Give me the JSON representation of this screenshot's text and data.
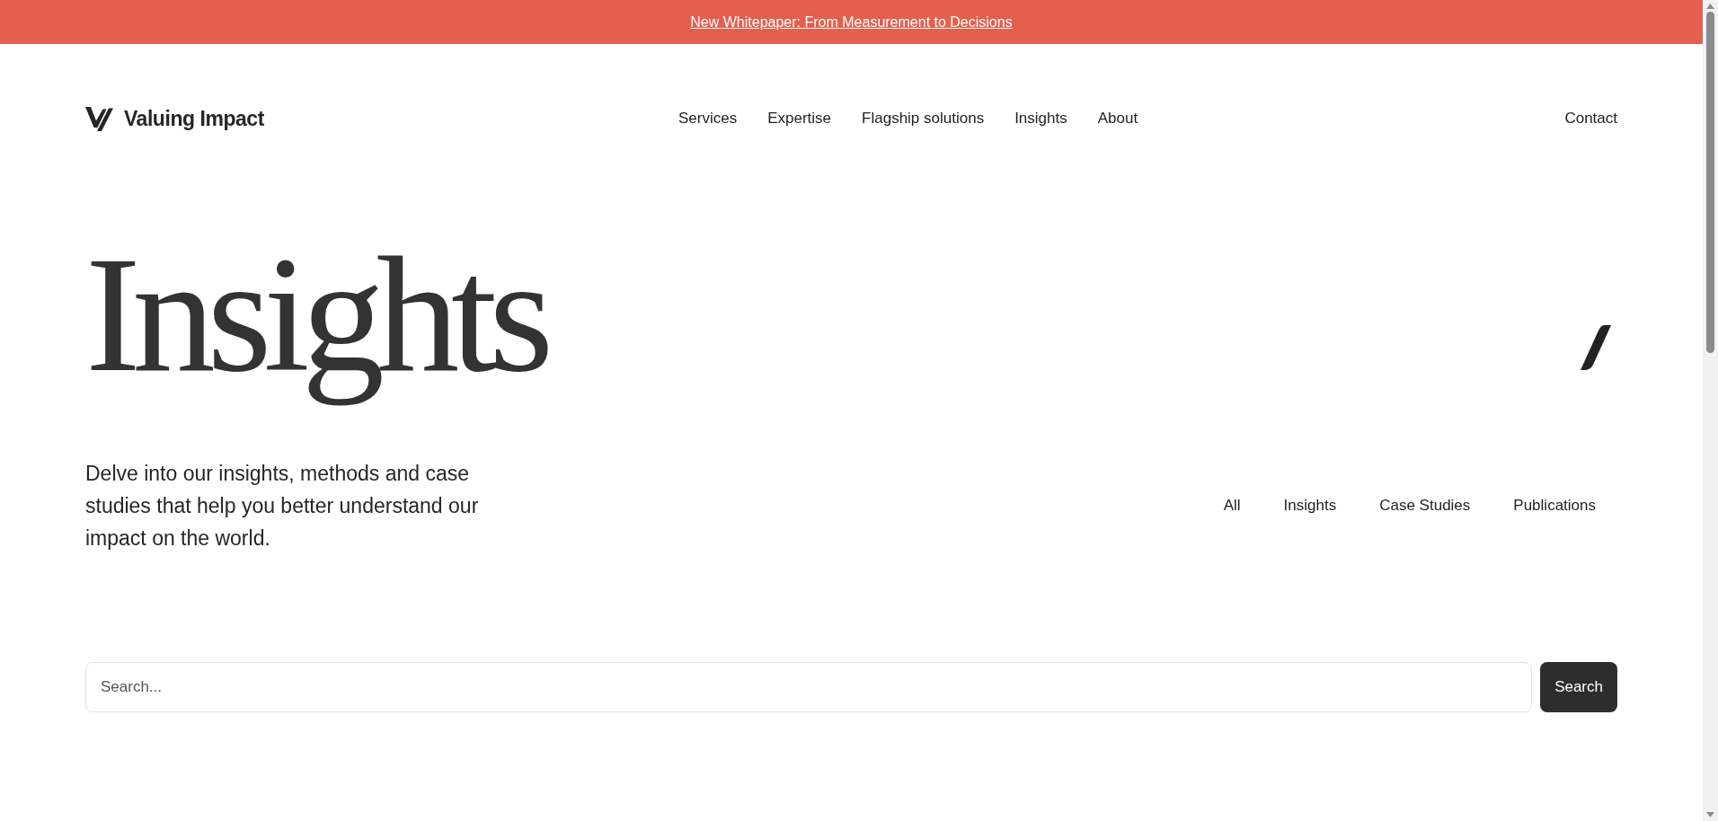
{
  "banner": {
    "link": "New Whitepaper: From Measurement to Decisions"
  },
  "header": {
    "logo_text": "Valuing Impact",
    "nav": [
      "Services",
      "Expertise",
      "Flagship solutions",
      "Insights",
      "About"
    ],
    "contact": "Contact"
  },
  "hero": {
    "title": "Insights",
    "description": "Delve into our insights, methods and case studies that help you better understand our impact on the world.",
    "filters": [
      "All",
      "Insights",
      "Case Studies",
      "Publications"
    ]
  },
  "search": {
    "placeholder": "Search...",
    "button": "Search"
  }
}
